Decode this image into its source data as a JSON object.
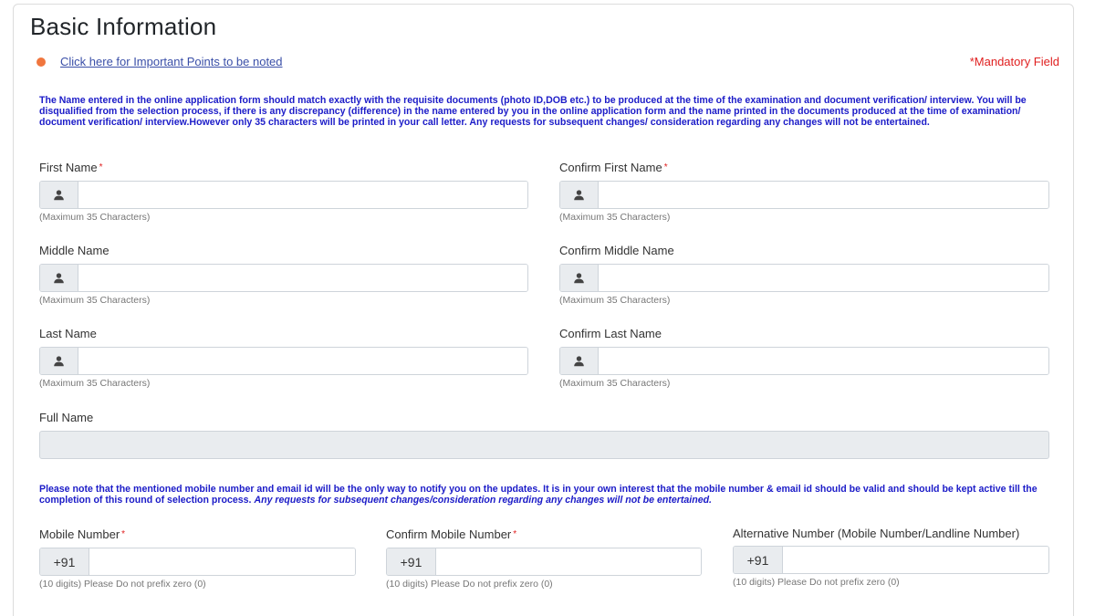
{
  "page": {
    "title": "Basic Information",
    "important_link": "Click here for Important Points to be noted",
    "mandatory_note": "*Mandatory Field",
    "name_notice": "The Name entered in the online application form should match exactly with the requisite documents (photo ID,DOB etc.) to be produced at the time of the examination and document verification/ interview. You will be disqualified from the selection process, if there is any discrepancy (difference) in the name entered by you in the online application form and the name printed in the documents produced at the time of examination/ document verification/ interview.However only 35 characters will be printed in your call letter. Any requests for subsequent changes/ consideration regarding any changes will not be entertained.",
    "contact_notice": "Please note that the mentioned mobile number and email id will be the only way to notify you on the updates. It is in your own interest that the mobile number & email id should be valid and should be kept active till the completion of this round of selection process.",
    "contact_notice_strong": "Any requests for subsequent changes/consideration regarding any changes will not be entertained."
  },
  "fields": {
    "first_name": {
      "label": "First Name",
      "required": "*",
      "value": "",
      "hint": "(Maximum 35 Characters)"
    },
    "confirm_first_name": {
      "label": "Confirm First Name",
      "required": "*",
      "value": "",
      "hint": "(Maximum 35 Characters)"
    },
    "middle_name": {
      "label": "Middle Name",
      "value": "",
      "hint": "(Maximum 35 Characters)"
    },
    "confirm_middle_name": {
      "label": "Confirm Middle Name",
      "value": "",
      "hint": "(Maximum 35 Characters)"
    },
    "last_name": {
      "label": "Last Name",
      "value": "",
      "hint": "(Maximum 35 Characters)"
    },
    "confirm_last_name": {
      "label": "Confirm Last Name",
      "value": "",
      "hint": "(Maximum 35 Characters)"
    },
    "full_name": {
      "label": "Full Name",
      "value": ""
    },
    "mobile": {
      "label": "Mobile Number",
      "required": "*",
      "code": "+91",
      "value": "",
      "hint": "(10 digits) Please Do not prefix zero (0)"
    },
    "confirm_mobile": {
      "label": "Confirm Mobile Number",
      "required": "*",
      "code": "+91",
      "value": "",
      "hint": "(10 digits) Please Do not prefix zero (0)"
    },
    "alternative": {
      "label": "Alternative Number (Mobile Number/Landline Number)",
      "code": "+91",
      "value": "",
      "hint": "(10 digits) Please Do not prefix zero (0)"
    }
  },
  "icons": {
    "name_addon": "user-icon",
    "bullet": "dot-icon"
  },
  "colors": {
    "notice": "#1c1cc8",
    "required": "#e02020",
    "bullet": "#f0763e",
    "link": "#3a4fa8"
  }
}
